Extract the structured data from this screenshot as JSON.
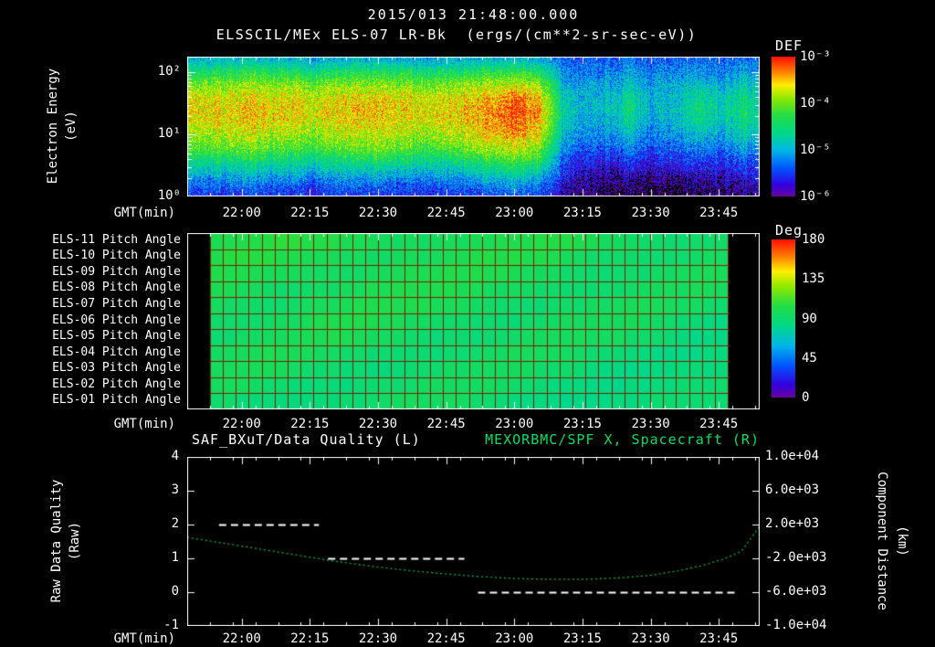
{
  "header": {
    "datetime_title": "2015/013 21:48:00.000",
    "spectrogram_title": "ELSSCIL/MEx ELS-07 LR-Bk  (ergs/(cm**2-sr-sec-eV))"
  },
  "axes": {
    "x_axis_label": "GMT(min)",
    "x_range_min": [
      0,
      126
    ],
    "x_minor_step_min": 5,
    "x_ticks": [
      {
        "label": "22:00",
        "min": 12
      },
      {
        "label": "22:15",
        "min": 27
      },
      {
        "label": "22:30",
        "min": 42
      },
      {
        "label": "22:45",
        "min": 57
      },
      {
        "label": "23:00",
        "min": 72
      },
      {
        "label": "23:15",
        "min": 87
      },
      {
        "label": "23:30",
        "min": 102
      },
      {
        "label": "23:45",
        "min": 117
      }
    ]
  },
  "panel1": {
    "ylabel_line1": "Electron Energy",
    "ylabel_line2": "(eV)",
    "y_ticks": [
      {
        "label": "10⁰",
        "exp": 0
      },
      {
        "label": "10¹",
        "exp": 1
      },
      {
        "label": "10²",
        "exp": 2
      }
    ],
    "colorbar": {
      "title": "DEF",
      "range": [
        -6,
        -3
      ],
      "ticks": [
        {
          "label": "10⁻³",
          "value": -3
        },
        {
          "label": "10⁻⁴",
          "value": -4
        },
        {
          "label": "10⁻⁵",
          "value": -5
        },
        {
          "label": "10⁻⁶",
          "value": -6
        }
      ]
    }
  },
  "panel2": {
    "row_labels": [
      "ELS-11 Pitch Angle",
      "ELS-10 Pitch Angle",
      "ELS-09 Pitch Angle",
      "ELS-08 Pitch Angle",
      "ELS-07 Pitch Angle",
      "ELS-06 Pitch Angle",
      "ELS-05 Pitch Angle",
      "ELS-04 Pitch Angle",
      "ELS-03 Pitch Angle",
      "ELS-02 Pitch Angle",
      "ELS-01 Pitch Angle"
    ],
    "colorbar": {
      "title": "Deg",
      "range": [
        0,
        180
      ],
      "ticks": [
        {
          "label": "180",
          "value": 180
        },
        {
          "label": "135",
          "value": 135
        },
        {
          "label": "90",
          "value": 90
        },
        {
          "label": "45",
          "value": 45
        },
        {
          "label": "0",
          "value": 0
        }
      ]
    }
  },
  "panel3": {
    "left_title": "SAF_BXuT/Data Quality (L)",
    "right_title": "MEXORBMC/SPF X, Spacecraft (R)",
    "left_ylabel_line1": "Raw Data Quality",
    "left_ylabel_line2": "(Raw)",
    "right_ylabel_line1": "Component Distance",
    "right_ylabel_line2": "(km)",
    "left_range": [
      -1,
      4
    ],
    "right_range": [
      -10000,
      10000
    ],
    "left_ticks": [
      {
        "label": "4",
        "value": 4
      },
      {
        "label": "3",
        "value": 3
      },
      {
        "label": "2",
        "value": 2
      },
      {
        "label": "1",
        "value": 1
      },
      {
        "label": "0",
        "value": 0
      },
      {
        "label": "-1",
        "value": -1
      }
    ],
    "right_ticks": [
      {
        "label": "1.0e+04",
        "value": 10000
      },
      {
        "label": "6.0e+03",
        "value": 6000
      },
      {
        "label": "2.0e+03",
        "value": 2000
      },
      {
        "label": "-2.0e+03",
        "value": -2000
      },
      {
        "label": "-6.0e+03",
        "value": -6000
      },
      {
        "label": "-1.0e+04",
        "value": -10000
      }
    ]
  },
  "colors": {
    "background": "#000000",
    "foreground": "#ffffff",
    "accent_green": "#00e060",
    "curve_green": "#00b148",
    "grid_red": "#7a2200",
    "colormap": [
      {
        "pos": 0.0,
        "color": "#66009e"
      },
      {
        "pos": 0.08,
        "color": "#3300e0"
      },
      {
        "pos": 0.2,
        "color": "#0055ff"
      },
      {
        "pos": 0.33,
        "color": "#00b8e8"
      },
      {
        "pos": 0.45,
        "color": "#00d88a"
      },
      {
        "pos": 0.58,
        "color": "#22dd44"
      },
      {
        "pos": 0.7,
        "color": "#8ce800"
      },
      {
        "pos": 0.8,
        "color": "#ffee00"
      },
      {
        "pos": 0.9,
        "color": "#ff7700"
      },
      {
        "pos": 1.0,
        "color": "#ff1100"
      }
    ]
  },
  "chart_data": [
    {
      "type": "heatmap",
      "name": "electron-energy-spectrogram",
      "title": "ELSSCIL/MEx ELS-07 LR-Bk",
      "units": "ergs/(cm**2-sr-sec-eV)",
      "x_start_time": "21:48",
      "x_range_min": [
        0,
        126
      ],
      "y_scale": "log",
      "y_range_ev": [
        1,
        180
      ],
      "z_label": "DEF",
      "z_log10_range": [
        -6,
        -3
      ],
      "time_bin_min": 5,
      "energy_bins_ev": [
        1.0,
        1.6,
        2.5,
        4.0,
        6.3,
        10,
        16,
        25,
        40,
        63,
        100,
        160
      ],
      "values_log10": [
        [
          -5.6,
          -5.3,
          -4.9,
          -4.5,
          -4.1,
          -3.9,
          -3.7,
          -3.6,
          -3.7,
          -4.0,
          -4.45,
          -4.95
        ],
        [
          -5.6,
          -5.3,
          -4.9,
          -4.5,
          -4.05,
          -3.85,
          -3.65,
          -3.6,
          -3.7,
          -4.0,
          -4.4,
          -4.9
        ],
        [
          -5.6,
          -5.25,
          -4.85,
          -4.4,
          -4.0,
          -3.8,
          -3.6,
          -3.55,
          -3.65,
          -3.95,
          -4.35,
          -4.9
        ],
        [
          -5.6,
          -5.3,
          -4.9,
          -4.5,
          -4.1,
          -3.85,
          -3.65,
          -3.6,
          -3.7,
          -4.0,
          -4.4,
          -4.95
        ],
        [
          -5.65,
          -5.35,
          -4.95,
          -4.55,
          -4.15,
          -3.9,
          -3.7,
          -3.6,
          -3.7,
          -4.0,
          -4.45,
          -5.0
        ],
        [
          -5.7,
          -5.4,
          -5.0,
          -4.6,
          -4.2,
          -3.95,
          -3.75,
          -3.65,
          -3.75,
          -4.05,
          -4.5,
          -5.05
        ],
        [
          -5.6,
          -5.3,
          -4.9,
          -4.5,
          -4.1,
          -3.85,
          -3.65,
          -3.6,
          -3.7,
          -4.0,
          -4.45,
          -5.0
        ],
        [
          -5.6,
          -5.3,
          -4.9,
          -4.45,
          -4.05,
          -3.8,
          -3.65,
          -3.55,
          -3.65,
          -3.95,
          -4.4,
          -4.95
        ],
        [
          -5.6,
          -5.3,
          -4.85,
          -4.4,
          -4.0,
          -3.8,
          -3.6,
          -3.55,
          -3.65,
          -3.95,
          -4.4,
          -4.95
        ],
        [
          -5.65,
          -5.35,
          -4.95,
          -4.5,
          -4.1,
          -3.85,
          -3.7,
          -3.6,
          -3.7,
          -4.0,
          -4.45,
          -5.0
        ],
        [
          -5.65,
          -5.35,
          -4.95,
          -4.55,
          -4.15,
          -3.9,
          -3.7,
          -3.65,
          -3.75,
          -4.05,
          -4.5,
          -5.05
        ],
        [
          -5.6,
          -5.3,
          -4.9,
          -4.5,
          -4.1,
          -3.85,
          -3.65,
          -3.6,
          -3.7,
          -4.0,
          -4.45,
          -5.0
        ],
        [
          -5.55,
          -5.25,
          -4.8,
          -4.35,
          -3.95,
          -3.7,
          -3.55,
          -3.5,
          -3.6,
          -3.9,
          -4.4,
          -4.95
        ],
        [
          -5.5,
          -5.15,
          -4.7,
          -4.25,
          -3.8,
          -3.55,
          -3.4,
          -3.35,
          -3.5,
          -3.85,
          -4.35,
          -4.9
        ],
        [
          -5.45,
          -5.05,
          -4.6,
          -4.1,
          -3.7,
          -3.4,
          -3.2,
          -3.1,
          -3.3,
          -3.75,
          -4.3,
          -4.9
        ],
        [
          -5.5,
          -5.2,
          -4.75,
          -4.3,
          -3.9,
          -3.6,
          -3.45,
          -3.4,
          -3.55,
          -3.9,
          -4.4,
          -4.95
        ],
        [
          -5.9,
          -5.75,
          -5.55,
          -5.35,
          -5.1,
          -4.9,
          -4.75,
          -4.7,
          -4.75,
          -4.95,
          -5.15,
          -5.35
        ],
        [
          -6.1,
          -5.95,
          -5.8,
          -5.6,
          -5.4,
          -5.2,
          -5.05,
          -5.0,
          -5.0,
          -5.1,
          -5.25,
          -5.4
        ],
        [
          -6.2,
          -6.0,
          -5.85,
          -5.6,
          -5.35,
          -5.1,
          -4.95,
          -4.85,
          -4.9,
          -5.05,
          -5.2,
          -5.4
        ],
        [
          -6.2,
          -6.05,
          -5.8,
          -5.55,
          -5.2,
          -4.95,
          -4.7,
          -4.6,
          -4.7,
          -4.9,
          -5.1,
          -5.3
        ],
        [
          -6.3,
          -6.1,
          -5.9,
          -5.65,
          -5.45,
          -5.25,
          -5.1,
          -5.0,
          -5.0,
          -5.1,
          -5.25,
          -5.4
        ],
        [
          -6.3,
          -6.1,
          -5.9,
          -5.6,
          -5.4,
          -5.15,
          -5.0,
          -4.95,
          -4.95,
          -5.05,
          -5.2,
          -5.4
        ],
        [
          -6.1,
          -5.95,
          -5.7,
          -5.45,
          -5.15,
          -4.85,
          -4.6,
          -4.5,
          -4.6,
          -4.85,
          -5.1,
          -5.3
        ],
        [
          -6.1,
          -5.95,
          -5.75,
          -5.55,
          -5.3,
          -5.05,
          -4.85,
          -4.75,
          -4.8,
          -5.0,
          -5.2,
          -5.4
        ],
        [
          -6.0,
          -5.85,
          -5.6,
          -5.35,
          -5.05,
          -4.75,
          -4.55,
          -4.5,
          -4.6,
          -4.8,
          -5.05,
          -5.25
        ],
        [
          -6.05,
          -5.9,
          -5.7,
          -5.5,
          -5.3,
          -5.1,
          -4.9,
          -4.85,
          -4.9,
          -5.0,
          -5.2,
          -5.4
        ]
      ]
    },
    {
      "type": "heatmap",
      "name": "pitch-angle-panel",
      "rows": 11,
      "z_label": "Deg",
      "z_range_deg": [
        0,
        180
      ],
      "data_start_min": 5,
      "data_end_min": 119,
      "grid_cols": 40,
      "row_mean_deg": [
        96,
        95,
        94,
        93,
        92,
        91,
        90,
        89,
        88,
        87,
        86
      ]
    },
    {
      "type": "line",
      "name": "quality-and-distance",
      "series": [
        {
          "name": "SAF_BXuT/Data Quality (L)",
          "axis": "left",
          "style": "dashed",
          "color": "#ffffff",
          "segments": [
            {
              "start_min": 7,
              "end_min": 29,
              "value": 2
            },
            {
              "start_min": 31,
              "end_min": 61,
              "value": 1
            },
            {
              "start_min": 64,
              "end_min": 121,
              "value": 0
            }
          ]
        },
        {
          "name": "MEXORBMC/SPF X, Spacecraft (R)",
          "axis": "right",
          "style": "dotted",
          "color": "#00b148",
          "points_min_km": [
            [
              0,
              480
            ],
            [
              8,
              -200
            ],
            [
              16,
              -900
            ],
            [
              24,
              -1600
            ],
            [
              32,
              -2300
            ],
            [
              40,
              -2900
            ],
            [
              48,
              -3400
            ],
            [
              56,
              -3800
            ],
            [
              64,
              -4150
            ],
            [
              72,
              -4380
            ],
            [
              80,
              -4480
            ],
            [
              88,
              -4470
            ],
            [
              96,
              -4280
            ],
            [
              102,
              -4000
            ],
            [
              108,
              -3480
            ],
            [
              113,
              -2900
            ],
            [
              118,
              -2100
            ],
            [
              122,
              -1150
            ],
            [
              126,
              1800
            ]
          ]
        }
      ]
    }
  ]
}
